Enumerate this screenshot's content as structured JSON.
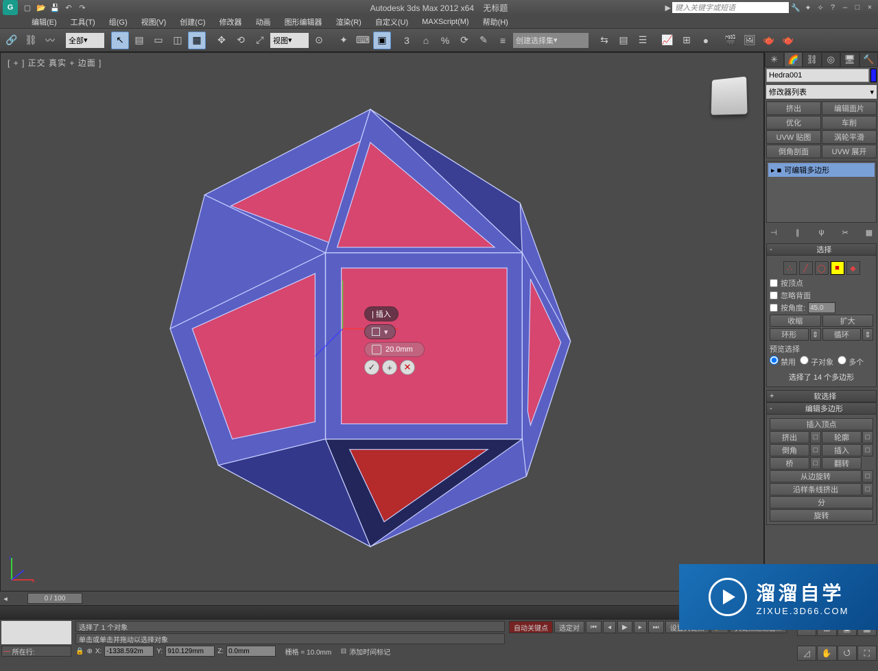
{
  "title": {
    "app": "Autodesk 3ds Max  2012 x64",
    "doc": "无标题"
  },
  "titlebar_search_placeholder": "键入关键字或短语",
  "menus": [
    "编辑(E)",
    "工具(T)",
    "组(G)",
    "视图(V)",
    "创建(C)",
    "修改器",
    "动画",
    "图形编辑器",
    "渲染(R)",
    "自定义(U)",
    "MAXScript(M)",
    "帮助(H)"
  ],
  "toolbar": {
    "filter_dd": "全部",
    "view_dd": "视图",
    "sel_set_dd": "创建选择集",
    "snap_angle": "3"
  },
  "viewport": {
    "label": "[ +  ] 正交  真实 + 边面 ]"
  },
  "caddy": {
    "title": "| 插入",
    "value": "20.0mm"
  },
  "cmd": {
    "obj_name": "Hedra001",
    "modlist_dd": "修改器列表",
    "modbtns": [
      "挤出",
      "编辑面片",
      "优化",
      "车削",
      "UVW 贴图",
      "涡轮平滑",
      "倒角剖面",
      "UVW 展开"
    ],
    "stack_item": "可编辑多边形",
    "rollout_select": "选择",
    "by_vertex": "按顶点",
    "ignore_back": "忽略背面",
    "by_angle": "按角度:",
    "by_angle_val": "45.0",
    "shrink": "收缩",
    "grow": "扩大",
    "ring": "环形",
    "loop": "循环",
    "preview_label": "预览选择",
    "preview_opts": [
      "禁用",
      "子对象",
      "多个"
    ],
    "sel_status": "选择了 14 个多边形",
    "rollout_soft": "软选择",
    "rollout_editpoly": "编辑多边形",
    "insert_vert": "插入顶点",
    "edit_btns": [
      "挤出",
      "轮廓",
      "倒角",
      "插入",
      "桥",
      "翻转"
    ],
    "from_edge_rot": "从边旋转",
    "along_spline": "沿样条线挤出",
    "bevel_profile": "分",
    "rotate": "旋转"
  },
  "timeline": {
    "pos": "0 / 100"
  },
  "status": {
    "sel": "选择了 1 个对象",
    "hint": "单击或单击并拖动以选择对象",
    "row_label": "所在行:",
    "x": "-1338.592m",
    "y": "910.129mm",
    "z": "0.0mm",
    "grid": "栅格 = 10.0mm",
    "auto_key": "自动关键点",
    "set_key": "设置关键点",
    "sel_list": "选定对",
    "key_filter": "关键点过滤器...",
    "add_time_tag": "添加时间标记"
  },
  "watermark": {
    "big": "溜溜自学",
    "small": "ZIXUE.3D66.COM"
  }
}
